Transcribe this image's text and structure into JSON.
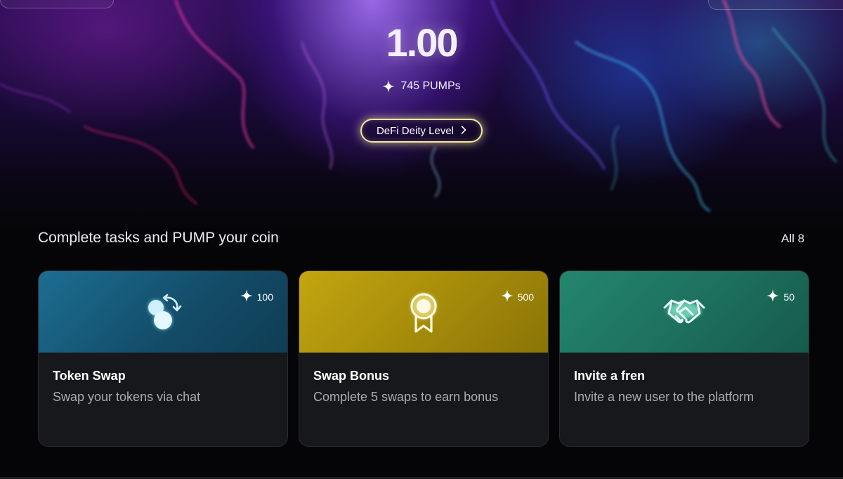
{
  "header": {
    "balance": "1.00",
    "pumps": "745 PUMPs",
    "level_button": "DeFi Deity Level"
  },
  "tasks": {
    "section_title": "Complete tasks and PUMP your coin",
    "all_link": "All 8",
    "cards": [
      {
        "title": "Token Swap",
        "description": "Swap your tokens via chat",
        "reward": "100",
        "color": "#1a5f80",
        "icon": "token-swap-icon"
      },
      {
        "title": "Swap Bonus",
        "description": "Complete 5 swaps to earn bonus",
        "reward": "500",
        "color": "#b59a0c",
        "icon": "award-ribbon-icon"
      },
      {
        "title": "Invite a fren",
        "description": "Invite a new user to the platform",
        "reward": "50",
        "color": "#1f7a66",
        "icon": "handshake-icon"
      }
    ]
  },
  "colors": {
    "level_glow": "#f3e7a6",
    "card_bg": "#17181b",
    "description_text": "#a8acb2"
  }
}
